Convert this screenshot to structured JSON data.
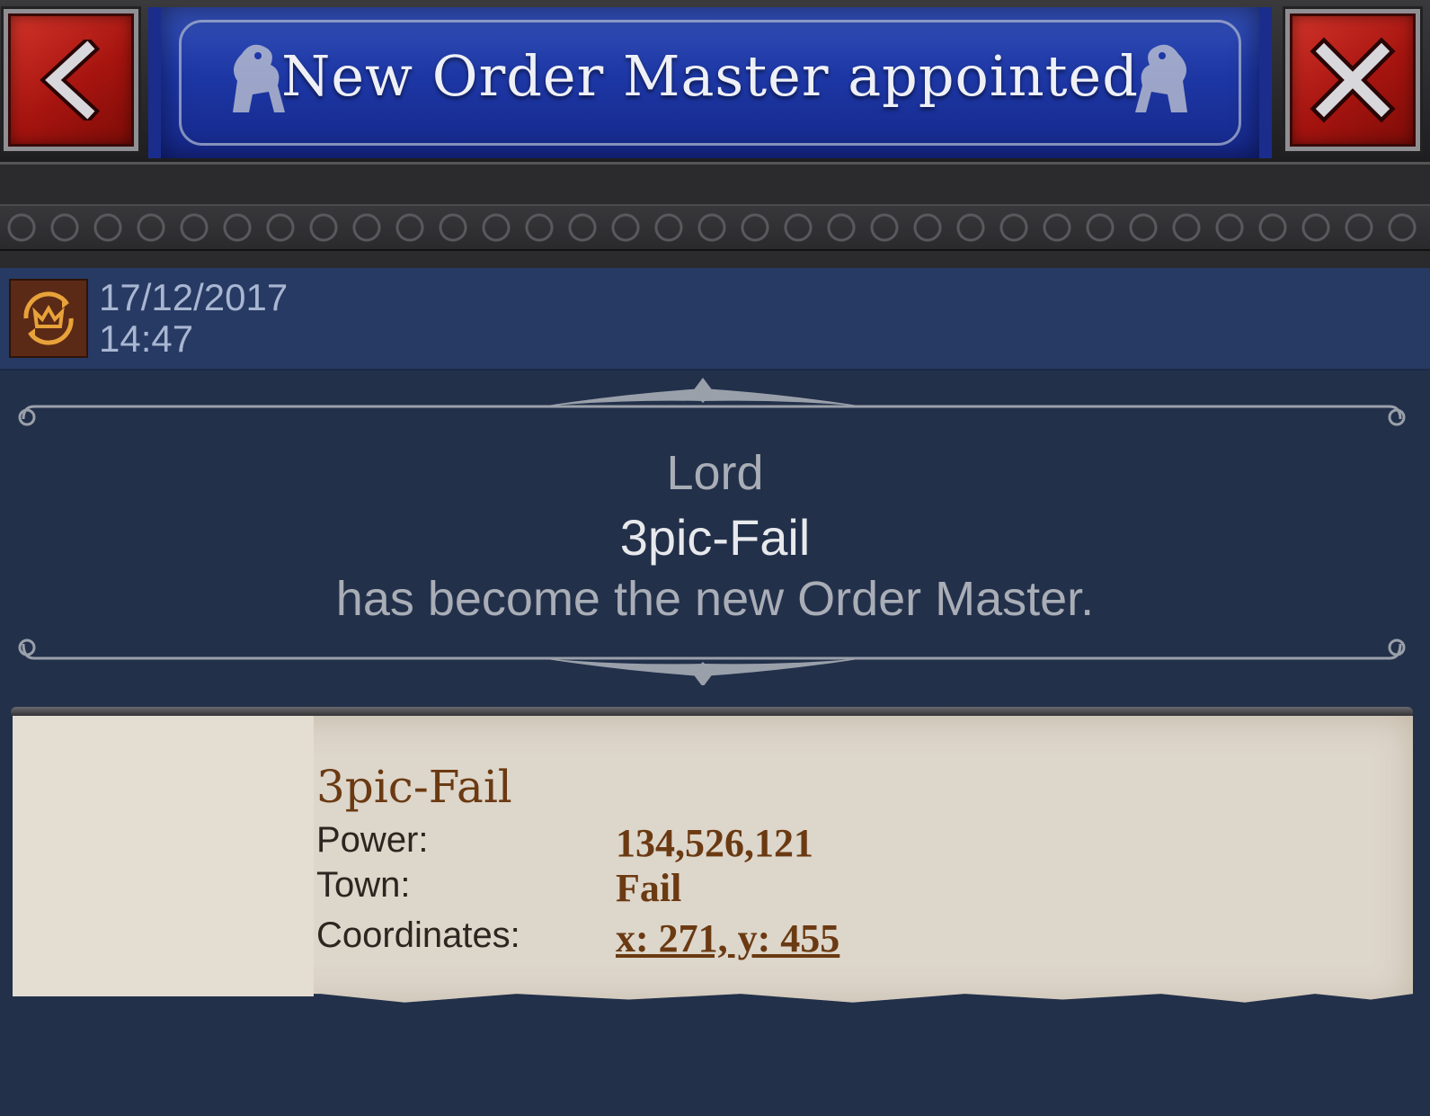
{
  "header": {
    "title": "New Order Master appointed",
    "back_icon": "chevron-left-icon",
    "close_icon": "close-x-icon",
    "accent_red": "#b8201a",
    "banner_blue": "#1d37a5"
  },
  "report": {
    "icon": "crown-cycle-icon",
    "date": "17/12/2017",
    "time": "14:47"
  },
  "message": {
    "line1": "Lord",
    "player_name": "3pic-Fail",
    "line3": "has become the new Order Master."
  },
  "details": {
    "name": "3pic-Fail",
    "power_label": "Power:",
    "power_value": "134,526,121",
    "town_label": "Town:",
    "town_value": "Fail",
    "coordinates_label": "Coordinates:",
    "coordinates_value": "x: 271, y: 455"
  }
}
